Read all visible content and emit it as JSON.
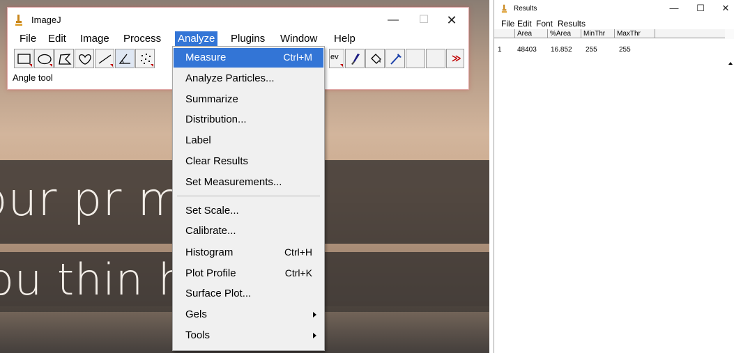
{
  "image_text": {
    "line1": "our pr    ms is",
    "line2": "ou thin    have t"
  },
  "imagej": {
    "title": "ImageJ",
    "window_controls": {
      "minimize": "—",
      "maximize": "☐",
      "close": "✕"
    },
    "menubar": [
      "File",
      "Edit",
      "Image",
      "Process",
      "Analyze",
      "Plugins",
      "Window",
      "Help"
    ],
    "active_menu": "Analyze",
    "toolbar_overflow": "≫",
    "toolbar_text_tool": "ev",
    "status": "Angle tool"
  },
  "analyze_menu": {
    "items": [
      {
        "label": "Measure",
        "shortcut": "Ctrl+M"
      },
      {
        "label": "Analyze Particles...",
        "shortcut": ""
      },
      {
        "label": "Summarize",
        "shortcut": ""
      },
      {
        "label": "Distribution...",
        "shortcut": ""
      },
      {
        "label": "Label",
        "shortcut": ""
      },
      {
        "label": "Clear Results",
        "shortcut": ""
      },
      {
        "label": "Set Measurements...",
        "shortcut": ""
      },
      {
        "label": "Set Scale...",
        "shortcut": ""
      },
      {
        "label": "Calibrate...",
        "shortcut": ""
      },
      {
        "label": "Histogram",
        "shortcut": "Ctrl+H"
      },
      {
        "label": "Plot Profile",
        "shortcut": "Ctrl+K"
      },
      {
        "label": "Surface Plot...",
        "shortcut": ""
      },
      {
        "label": "Gels",
        "shortcut": ""
      },
      {
        "label": "Tools",
        "shortcut": ""
      }
    ],
    "highlight_color": "#3375d6"
  },
  "results": {
    "title": "Results",
    "window_controls": {
      "minimize": "—",
      "maximize": "☐",
      "close": "✕"
    },
    "menubar": [
      "File",
      "Edit",
      "Font",
      "Results"
    ],
    "columns": [
      "",
      "Area",
      "%Area",
      "MinThr",
      "MaxThr"
    ],
    "rows": [
      [
        "1",
        "48403",
        "16.852",
        "255",
        "255"
      ]
    ]
  }
}
